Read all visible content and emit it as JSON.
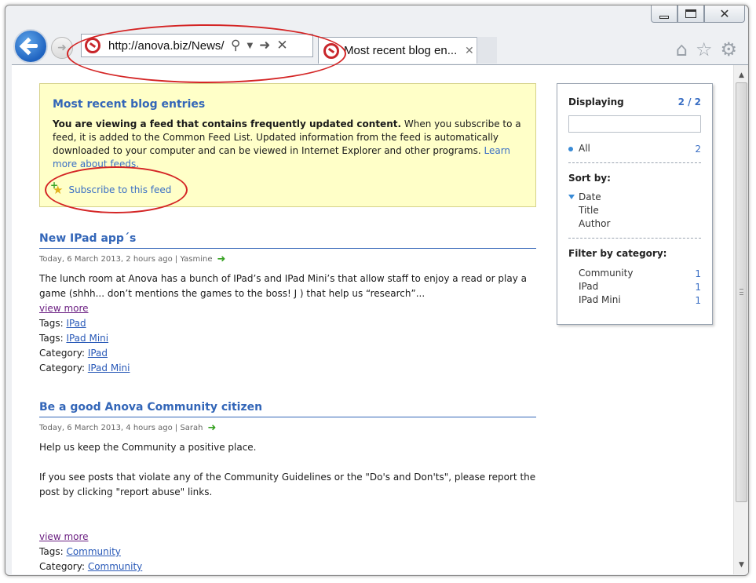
{
  "browser": {
    "address": "http://anova.biz/News/",
    "tab_title": "Most recent blog en...",
    "tab_close": "✕",
    "caption": {
      "minimize": "",
      "maximize": "",
      "close": "✕"
    }
  },
  "feed": {
    "heading": "Most recent blog entries",
    "notice_bold": "You are viewing a feed that contains frequently updated content.",
    "notice_text": " When you subscribe to a feed, it is added to the Common Feed List. Updated information from the feed is automatically downloaded to your computer and can be viewed in Internet Explorer and other programs. ",
    "learn_more": "Learn more about feeds.",
    "subscribe": "Subscribe to this feed"
  },
  "posts": [
    {
      "title": "New IPad app´s",
      "meta": "Today, 6 March 2013, 2 hours ago | Yasmine",
      "body": "The lunch room at Anova has a bunch of IPad’s and IPad Mini’s that allow staff to enjoy a read or play a game (shhh... don’t mentions the games to the boss! J ) that help us “research”...",
      "view_more": "view more",
      "tags": [
        {
          "label": "Tags:",
          "value": "IPad"
        },
        {
          "label": "Tags:",
          "value": "IPad Mini"
        },
        {
          "label": "Category:",
          "value": "IPad"
        },
        {
          "label": "Category:",
          "value": "IPad Mini"
        }
      ]
    },
    {
      "title": "Be a good Anova Community citizen",
      "meta": "Today, 6 March 2013, 4 hours ago | Sarah",
      "body1": "Help us keep the Community a positive place.",
      "body2": "If you see posts that violate any of the Community Guidelines or the \"Do's and Don'ts\", please report the post by clicking \"report abuse\" links.",
      "view_more": "view more",
      "tags": [
        {
          "label": "Tags:",
          "value": "Community"
        },
        {
          "label": "Category:",
          "value": "Community"
        }
      ]
    }
  ],
  "sidebar": {
    "displaying_label": "Displaying",
    "displaying_count": "2 / 2",
    "all_label": "All",
    "all_count": "2",
    "sort_heading": "Sort by:",
    "sort_options": [
      "Date",
      "Title",
      "Author"
    ],
    "filter_heading": "Filter by category:",
    "categories": [
      {
        "name": "Community",
        "count": "1"
      },
      {
        "name": "IPad",
        "count": "1"
      },
      {
        "name": "IPad Mini",
        "count": "1"
      }
    ]
  },
  "colors": {
    "accent": "#3366b8",
    "feed_bg": "#ffffc8",
    "annotation": "#d42525"
  }
}
